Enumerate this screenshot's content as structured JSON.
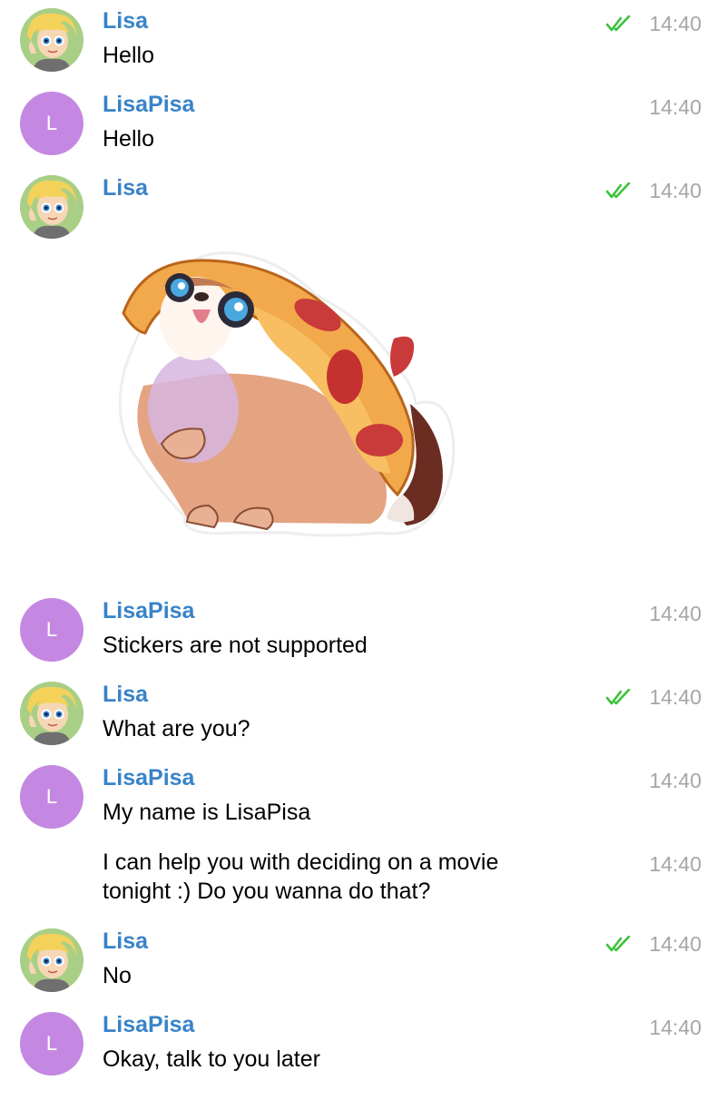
{
  "colors": {
    "author": "#3883c8",
    "time": "#a6a6a6",
    "read_check": "#3cc33c",
    "bot_avatar": "#c488e2"
  },
  "messages": [
    {
      "author": "Lisa",
      "text": "Hello",
      "time": "14:40",
      "avatar": "photo",
      "read": true
    },
    {
      "author": "LisaPisa",
      "avatar_letter": "L",
      "text": "Hello",
      "time": "14:40"
    },
    {
      "author": "Lisa",
      "time": "14:40",
      "avatar": "photo",
      "read": true,
      "sticker": "pug-in-pizza-sticker"
    },
    {
      "author": "LisaPisa",
      "avatar_letter": "L",
      "text": "Stickers are not supported",
      "time": "14:40"
    },
    {
      "author": "Lisa",
      "text": "What are you?",
      "time": "14:40",
      "avatar": "photo",
      "read": true
    },
    {
      "author": "LisaPisa",
      "avatar_letter": "L",
      "text": "My name is LisaPisa",
      "time": "14:40"
    },
    {
      "text_line1": "I can help you with deciding on a movie",
      "text_line2": "tonight :) Do you wanna do that?",
      "time": "14:40"
    },
    {
      "author": "Lisa",
      "text": "No",
      "time": "14:40",
      "avatar": "photo",
      "read": true
    },
    {
      "author": "LisaPisa",
      "avatar_letter": "L",
      "text": "Okay, talk to you later",
      "time": "14:40"
    }
  ]
}
